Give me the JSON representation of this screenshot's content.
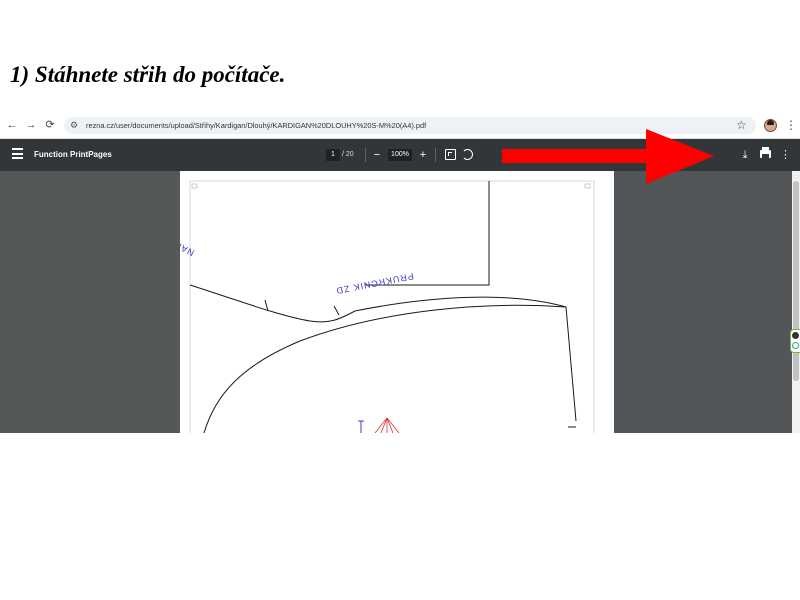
{
  "heading": "1) Stáhnete střih do počítače.",
  "browser": {
    "url": "rezna.cz/user/documents/upload/Střihy/Kardigan/Dlouhý/KARDIGAN%20DLOUHY%20S-M%20(A4).pdf"
  },
  "pdf_toolbar": {
    "title": "Function PrintPages",
    "current_page": "1",
    "total_pages": "/ 20",
    "zoom": "100%"
  },
  "pattern": {
    "label_top": "PRUKRCNIK ZD",
    "label_left": "NARAN",
    "line_color": "#1a1a1a",
    "text_color": "#3d3dc8",
    "accent_red": "#d93030"
  },
  "annotation": {
    "arrow_color": "#ff0000",
    "points_to": "download-icon"
  },
  "icons": {
    "back": "arrow-left-icon",
    "forward": "arrow-right-icon",
    "reload": "reload-icon",
    "site_settings": "tune-icon",
    "bookmark": "star-icon",
    "profile": "avatar",
    "browser_menu": "kebab-icon",
    "sidebar_toggle": "hamburger-icon",
    "zoom_out": "minus-icon",
    "zoom_in": "plus-icon",
    "fit": "fit-page-icon",
    "rotate": "rotate-icon",
    "download": "download-icon",
    "print": "print-icon",
    "more": "more-vert-icon"
  }
}
